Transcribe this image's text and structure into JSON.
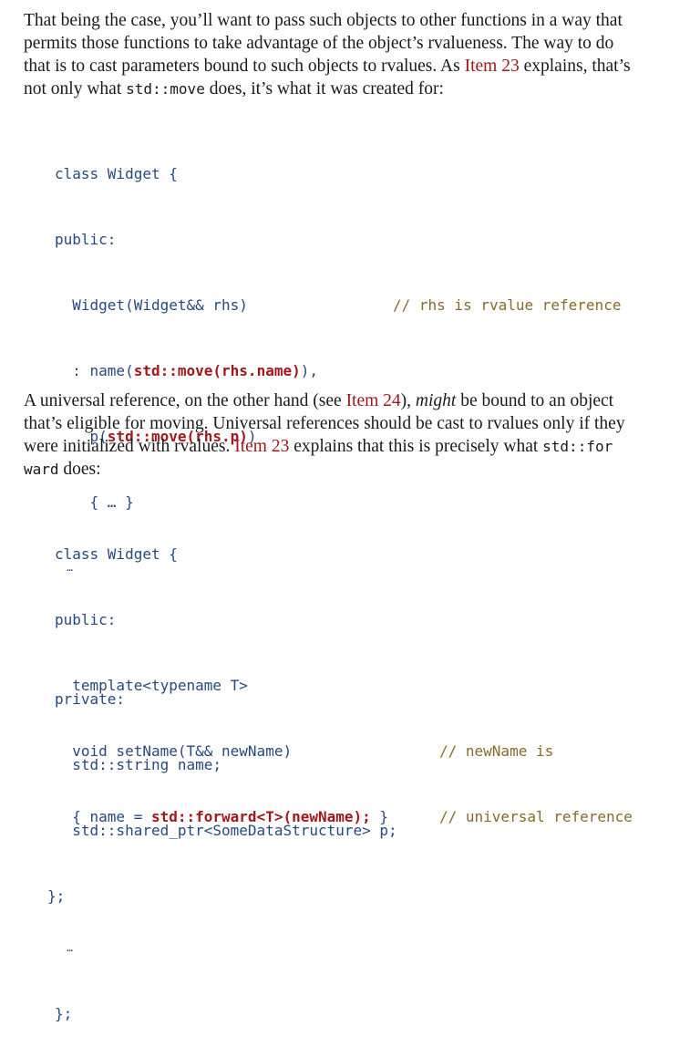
{
  "para1": {
    "l1": "That being the case, you’ll want to pass such objects to other functions in a way that",
    "l2": "permits those functions to take advantage of the object’s rvalueness. The way to do",
    "l3a": "that is to cast parameters bound to such objects to rvalues. As ",
    "l3ref": "Item 23",
    "l3b": " explains, that’s",
    "l4a": "not only what ",
    "l4code": "std::move",
    "l4b": " does, it’s what it was created for:"
  },
  "code1": {
    "c1": "class Widget {",
    "c2": "public:",
    "c3": "  Widget(Widget&& rhs)",
    "c3comment": "// rhs is rvalue reference",
    "c4a": "  : name(",
    "c4b": "std::move(rhs.name)",
    "c4c": "),",
    "c5a": "    p(",
    "c5b": "std::move(rhs.p)",
    "c5c": ")",
    "c6": "    { … }",
    "c7": "  …",
    "c8": "private:",
    "c9": "  std::string name;",
    "c10": "  std::shared_ptr<SomeDataStructure> p;",
    "c11": "};"
  },
  "para2": {
    "l1a": "A universal reference, on the other hand (see ",
    "l1ref": "Item 24",
    "l1b": "), ",
    "l1em": "might",
    "l1c": " be bound to an object",
    "l2": "that’s eligible for moving. Universal references should be cast to rvalues only if they",
    "l3a": "were initialized with rvalues. ",
    "l3ref": "Item 23",
    "l3b": " explains that this is precisely what ",
    "l3code": "std::for",
    "l4code": "ward",
    "l4b": " does:"
  },
  "code2": {
    "c1": "class Widget {",
    "c2": "public:",
    "c3": "  template<typename T>",
    "c4": "  void setName(T&& newName)",
    "c4comment": "// newName is",
    "c5a": "  { name = ",
    "c5b": "std::forward<T>(newName);",
    "c5c": " }",
    "c5comment": "// universal reference",
    "c6": "  …",
    "c7": "};"
  }
}
